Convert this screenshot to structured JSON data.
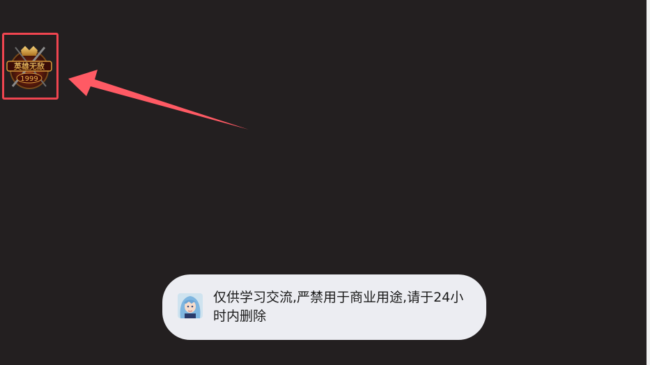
{
  "app_icon": {
    "name": "game-launcher-icon",
    "label_lines": [
      "英雄无敌",
      "1999"
    ],
    "highlight_color": "#f04550"
  },
  "annotation": {
    "arrow_color": "#ff5a64"
  },
  "toast": {
    "message": "仅供学习交流,严禁用于商业用途,请于24小时内删除",
    "avatar": "anime-avatar-icon"
  },
  "colors": {
    "background": "#231f20",
    "toast_background": "#ecedf2"
  }
}
